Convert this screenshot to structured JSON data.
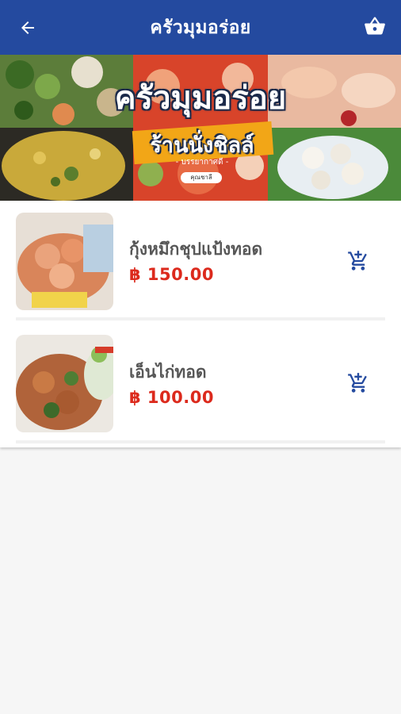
{
  "appbar": {
    "title": "ครัวมุมอร่อย",
    "back_icon": "arrow-left-icon",
    "cart_icon": "basket-icon"
  },
  "banner": {
    "title": "ครัวมุมอร่อย",
    "subtitle": "ร้านนั่งชิลล์",
    "small_text": "- บรรยากาศดี -",
    "pill_text": "คุณชาลี"
  },
  "menu": [
    {
      "name": "กุ้งหมึกชุปแป้งทอด",
      "price": "฿ 150.00",
      "cart_icon": "add-to-cart-icon"
    },
    {
      "name": "เอ็นไก่ทอด",
      "price": "฿ 100.00",
      "cart_icon": "add-to-cart-icon"
    }
  ],
  "colors": {
    "primary": "#244a9f",
    "price": "#dc2a1d",
    "name": "#575757",
    "background": "#f6f6f6"
  }
}
